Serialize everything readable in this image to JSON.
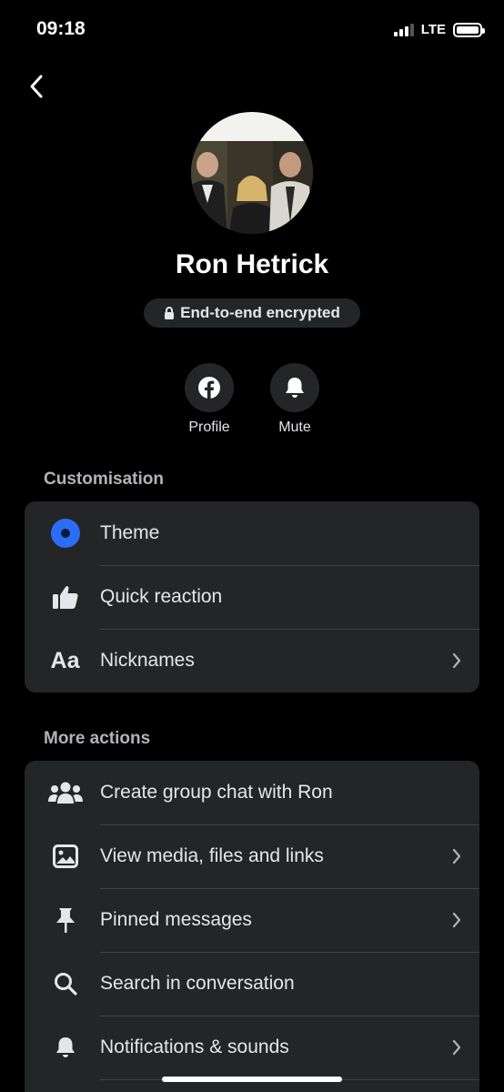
{
  "status_bar": {
    "time": "09:18",
    "network": "LTE"
  },
  "profile": {
    "name": "Ron Hetrick",
    "encryption_label": "End-to-end encrypted"
  },
  "actions": [
    {
      "label": "Profile",
      "icon": "facebook-icon"
    },
    {
      "label": "Mute",
      "icon": "bell-icon"
    }
  ],
  "customisation": {
    "title": "Customisation",
    "items": [
      {
        "label": "Theme",
        "icon": "theme-icon"
      },
      {
        "label": "Quick reaction",
        "icon": "thumbs-up-icon"
      },
      {
        "label": "Nicknames",
        "icon": "aa-text-icon",
        "icon_text": "Aa"
      }
    ]
  },
  "more_actions": {
    "title": "More actions",
    "items": [
      {
        "label": "Create group chat with Ron",
        "icon": "group-icon"
      },
      {
        "label": "View media, files and links",
        "icon": "image-icon"
      },
      {
        "label": "Pinned messages",
        "icon": "pin-icon"
      },
      {
        "label": "Search in conversation",
        "icon": "search-icon"
      },
      {
        "label": "Notifications & sounds",
        "icon": "bell-icon"
      }
    ]
  },
  "colors": {
    "accent": "#2b6df5",
    "background": "#000000",
    "card": "#242526",
    "text_primary": "#e4e6eb",
    "text_secondary": "#b0b3b8"
  }
}
